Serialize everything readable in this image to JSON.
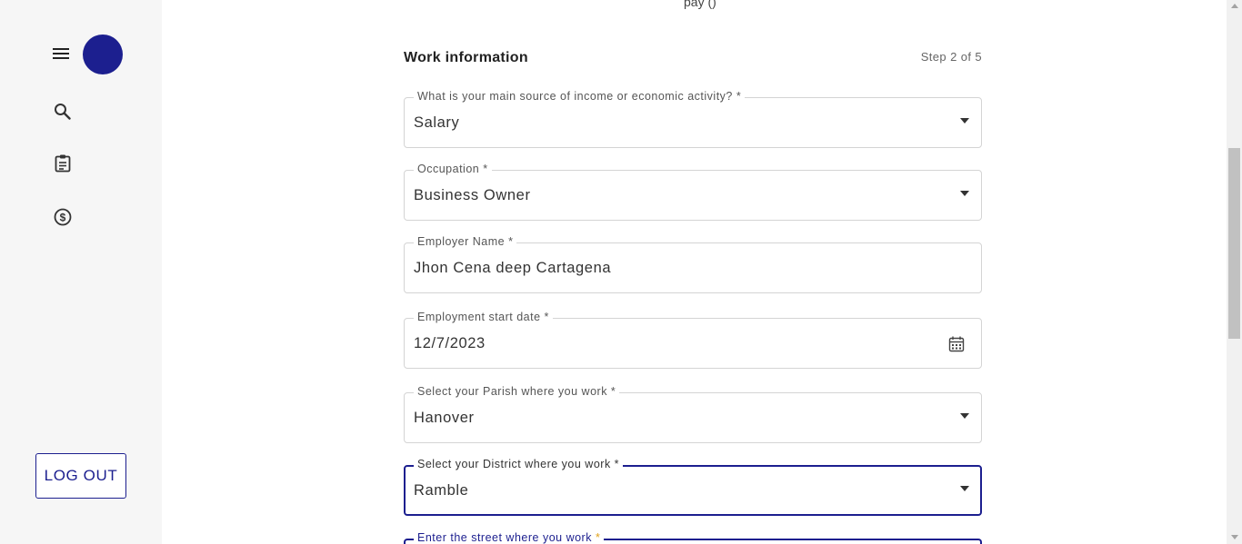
{
  "sidebar": {
    "logout_label": "LOG OUT"
  },
  "header": {
    "top_cut_text": "pay       ()",
    "section_title": "Work information",
    "step": "Step 2 of 5"
  },
  "fields": [
    {
      "label": "What is your main source of income or economic activity? *",
      "value": "Salary"
    },
    {
      "label": "Occupation *",
      "value": "Business Owner"
    },
    {
      "label": "Employer Name *",
      "value": "Jhon Cena deep Cartagena"
    },
    {
      "label": "Employment start date *",
      "value": "12/7/2023"
    },
    {
      "label": "Select your Parish where you work *",
      "value": "Hanover"
    },
    {
      "label": "Select your District where you work *",
      "value": "Ramble"
    },
    {
      "label": "Enter the street where you work",
      "value": ""
    }
  ],
  "partial_field_required_mark": "*",
  "colors": {
    "accent": "#1c1f8f",
    "avatar": "#1c1f8f",
    "required_mark_partial": "#e0a21b"
  },
  "icons": [
    "menu-icon",
    "search-icon",
    "clipboard-icon",
    "dollar-circle-icon",
    "calendar-icon",
    "chevron-down-icon"
  ]
}
